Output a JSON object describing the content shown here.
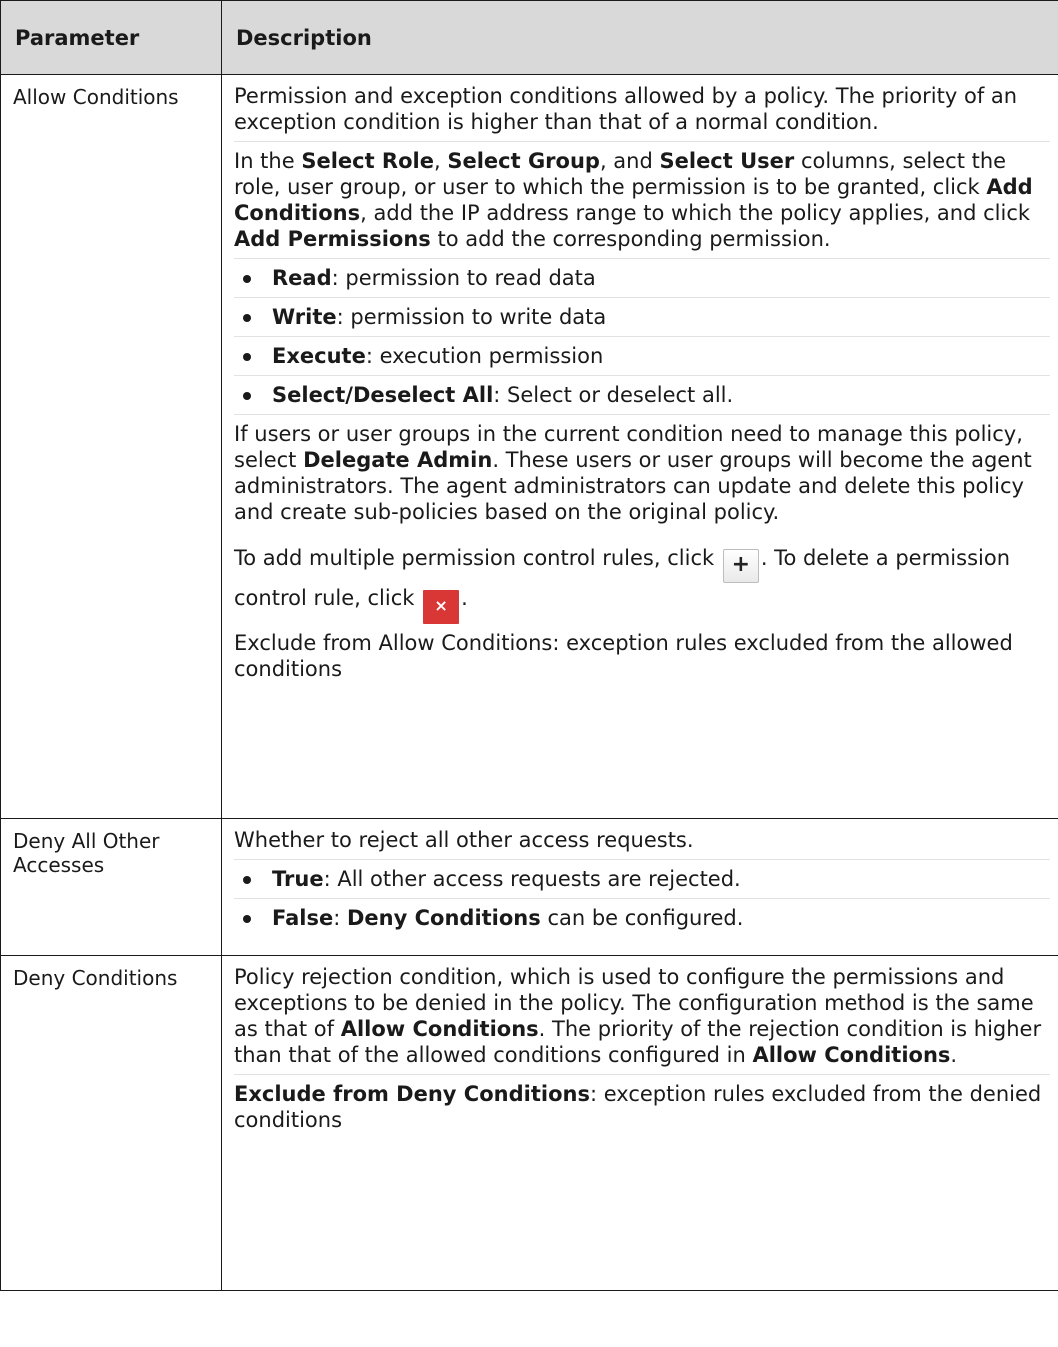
{
  "header": {
    "col1": "Parameter",
    "col2": "Description"
  },
  "rows": [
    {
      "param": "Allow Conditions",
      "p1": "Permission and exception conditions allowed by a policy. The priority of an exception condition is higher than that of a normal condition.",
      "p2": {
        "t1": "In the ",
        "b1": "Select Role",
        "t2": ", ",
        "b2": "Select Group",
        "t3": ", and ",
        "b3": "Select User",
        "t4": " columns, select the role, user group, or user to which the permission is to be granted, click ",
        "b4": "Add Conditions",
        "t5": ", add the IP address range to which the policy applies, and click ",
        "b5": "Add Permissions",
        "t6": " to add the corresponding permission."
      },
      "bullets": [
        {
          "b": "Read",
          "t": ": permission to read data"
        },
        {
          "b": "Write",
          "t": ": permission to write data"
        },
        {
          "b": "Execute",
          "t": ": execution permission"
        },
        {
          "b": "Select/Deselect All",
          "t": ": Select or deselect all."
        }
      ],
      "p3": {
        "t1": "If users or user groups in the current condition need to manage this policy, select ",
        "b1": "Delegate Admin",
        "t2": ". These users or user groups will become the agent administrators. The agent administrators can update and delete this policy and create sub-policies based on the original policy."
      },
      "p4": {
        "t1": "To add multiple permission control rules, click ",
        "t2": ". To delete a permission control rule, click ",
        "t3": ".",
        "add_icon": "+",
        "delete_icon": "×"
      },
      "p5": "Exclude from Allow Conditions: exception rules excluded from the allowed conditions"
    },
    {
      "param": "Deny All Other Accesses",
      "p1": "Whether to reject all other access requests.",
      "bullets": [
        {
          "b": "True",
          "t": ": All other access requests are rejected."
        },
        {
          "b": "False",
          "t": ": ",
          "b2": "Deny Conditions",
          "t2": " can be configured."
        }
      ]
    },
    {
      "param": "Deny Conditions",
      "p1": {
        "t1": "Policy rejection condition, which is used to configure the permissions and exceptions to be denied in the policy. The configuration method is the same as that of ",
        "b1": "Allow Conditions",
        "t2": ". The priority of the rejection condition is higher than that of the allowed conditions configured in ",
        "b2": "Allow Conditions",
        "t3": "."
      },
      "p2": {
        "b1": "Exclude from Deny Conditions",
        "t1": ": exception rules excluded from the denied conditions"
      }
    }
  ],
  "colors": {
    "header_bg": "#d9d9d9",
    "border": "#1a1a1a",
    "delete_button": "#d93636"
  }
}
